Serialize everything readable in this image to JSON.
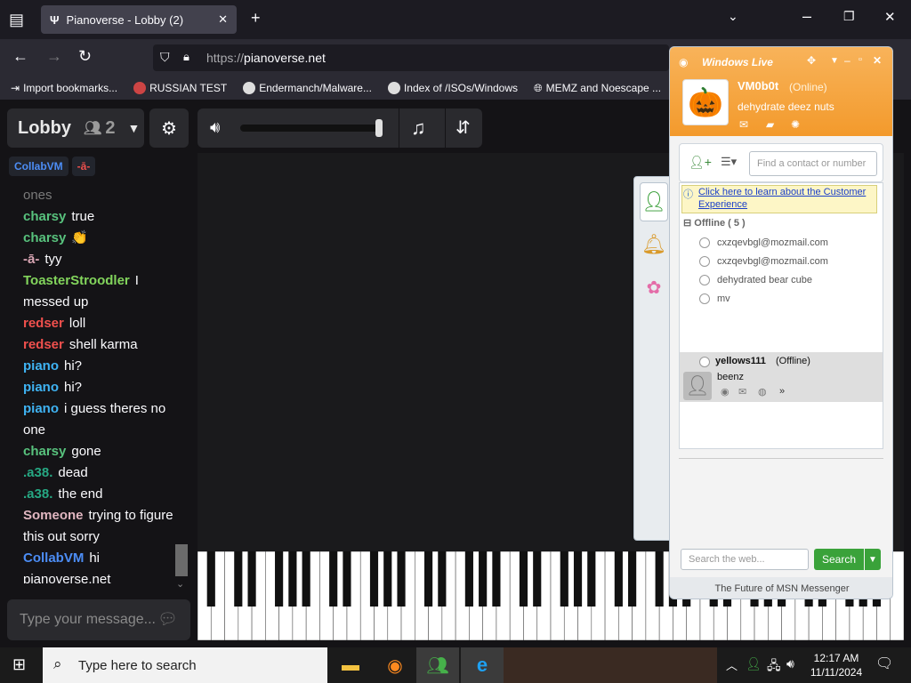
{
  "browser": {
    "tab_title": "Pianoverse - Lobby (2)",
    "url_prefix": "https://",
    "url_domain": "pianoverse.net",
    "bookmarks": [
      "Import bookmarks...",
      "RUSSIAN TEST",
      "Endermanch/Malware...",
      "Index of /ISOs/Windows",
      "MEMZ and Noescape ..."
    ]
  },
  "lobby": {
    "title": "Lobby",
    "user_count": "2",
    "chips": [
      "CollabVM",
      "-ā-"
    ],
    "input_placeholder": "Type your message..."
  },
  "chat": [
    {
      "user": "",
      "text": "ones",
      "color": "#7a7a7a"
    },
    {
      "user": "charsy",
      "text": "true",
      "color": "#58c27d"
    },
    {
      "user": "charsy",
      "text": "👏",
      "color": "#58c27d"
    },
    {
      "user": "-ā-",
      "text": "tyy",
      "color": "#d8a5b3"
    },
    {
      "user": "ToasterStroodler",
      "text": "I messed up",
      "color": "#82d45c"
    },
    {
      "user": "redser",
      "text": "loll",
      "color": "#f0504d"
    },
    {
      "user": "redser",
      "text": "shell karma",
      "color": "#f0504d"
    },
    {
      "user": "piano",
      "text": "hi?",
      "color": "#3fb3f3"
    },
    {
      "user": "piano",
      "text": "hi?",
      "color": "#3fb3f3"
    },
    {
      "user": "piano",
      "text": "i guess theres no one",
      "color": "#3fb3f3"
    },
    {
      "user": "charsy",
      "text": "gone",
      "color": "#58c27d"
    },
    {
      "user": ".a38.",
      "text": "dead",
      "color": "#26a883"
    },
    {
      "user": ".a38.",
      "text": "the end",
      "color": "#26a883"
    },
    {
      "user": "Someone",
      "text": "trying to figure this out sorry",
      "color": "#e0b6c0"
    },
    {
      "user": "CollabVM",
      "text": "hi pianoverse.net",
      "color": "#4c8df5"
    }
  ],
  "msn": {
    "title": "Windows Live",
    "username": "VM0b0t",
    "status": "(Online)",
    "message": "dehydrate deez nuts",
    "find_placeholder": "Find a contact or number",
    "info_text": "Click here to learn about the Customer Experience",
    "group": "Offline ( 5 )",
    "contacts": [
      "cxzqevbgl@mozmail.com",
      "cxzqevbgl@mozmail.com",
      "dehydrated bear cube",
      "mv"
    ],
    "selected_name": "yellows111",
    "selected_status": "(Offline)",
    "selected_msg": "beenz",
    "search_placeholder": "Search the web...",
    "search_button": "Search",
    "footer": "The Future of MSN Messenger"
  },
  "taskbar": {
    "search_placeholder": "Type here to search",
    "time": "12:17 AM",
    "date": "11/11/2024"
  }
}
